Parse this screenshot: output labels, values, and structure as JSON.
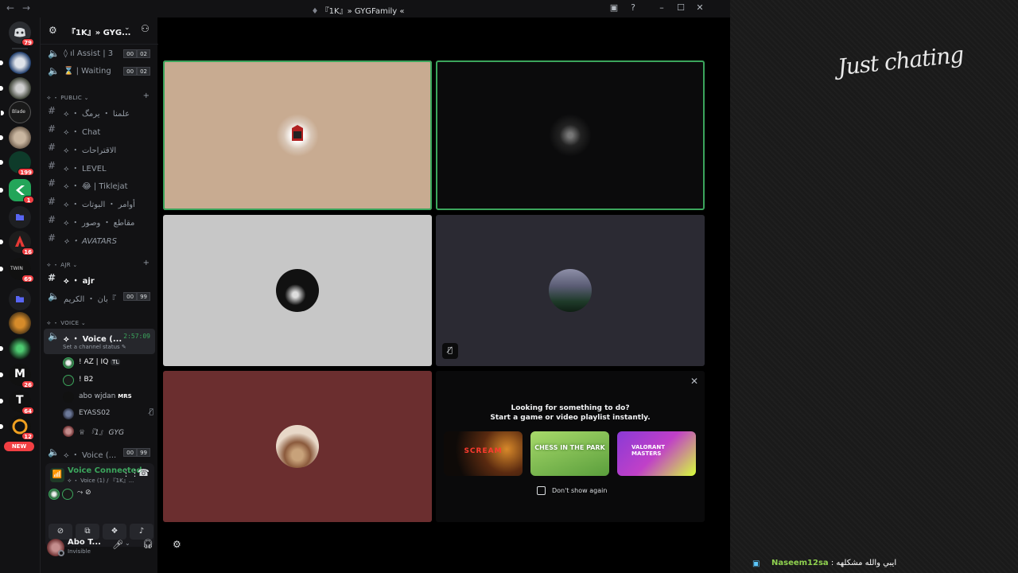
{
  "window": {
    "title": "『1K』» GYGFamily «",
    "back_icon": "←",
    "forward_icon": "→"
  },
  "rail": {
    "badges": [
      "79",
      "199",
      "1",
      "16",
      "69",
      "26",
      "64",
      "12"
    ],
    "new_label": "NEW"
  },
  "server": {
    "name": "『1K』» GYG..."
  },
  "channels": {
    "top": [
      {
        "label": "◊ ıl Assist | 3",
        "counts": [
          "00",
          "02"
        ]
      },
      {
        "label": "⌛ |  Waiting",
        "counts": [
          "00",
          "02"
        ]
      }
    ],
    "public_category": "PUBLIC",
    "public": [
      "⟡ ・ علمنا ・ يرمگ",
      "⟡ ・ Chat",
      "⟡ ・ الاقتراحات",
      "⟡ ・ LEVEL",
      "⟡ ・ 😂 | Tiklejat",
      "⟡ ・ أوامر ・ البوتات",
      "⟡ ・ مقاطع ・ وصور",
      "⟡ ・ AVATARS"
    ],
    "ajr_category": "AJR",
    "ajr": [
      {
        "label": "⟡ ・ ajr"
      },
      {
        "label": "بان ・ الكريم『",
        "counts": [
          "00",
          "99"
        ]
      }
    ],
    "voice_category": "VOICE",
    "voice_channel": "⟡ ・ Voice (...",
    "voice_timer": "2:57:09",
    "voice_status": "Set a channel status",
    "voice_users": [
      {
        "name": "! AZ | IQ",
        "tag": "TL"
      },
      {
        "name": "! B2"
      },
      {
        "name": "abo wjdan",
        "tag": "MRS"
      },
      {
        "name": "EYASS02"
      },
      {
        "name": "♕ 『1』 GYG"
      }
    ],
    "voice_channel_2": "⟡ ・ Voice (...",
    "voice_channel_2_counts": [
      "00",
      "99"
    ]
  },
  "voice_panel": {
    "status": "Voice Connected",
    "channel": "⟡ ・ Voice (1) / 『1K』..."
  },
  "user": {
    "name": "Abo T...",
    "status": "Invisible"
  },
  "activity": {
    "line1": "Looking for something to do?",
    "line2": "Start a game or video playlist instantly.",
    "games": [
      "SCREAM",
      "CHESS IN THE PARK",
      "VALORANT MASTERS"
    ],
    "dont_show": "Don't show again"
  },
  "overlay": {
    "category": "Just chating",
    "chat_user": "Naseem12sa",
    "chat_message": ": ايبي والله مشكلهه"
  },
  "colors": {
    "speaking": "#3ba55c",
    "tile_tan": "#c8ab91",
    "tile_grey": "#c7c7c7",
    "tile_slate": "#2b2a33",
    "tile_maroon": "#6b2e2f",
    "chat_user": "#8fd14f"
  }
}
